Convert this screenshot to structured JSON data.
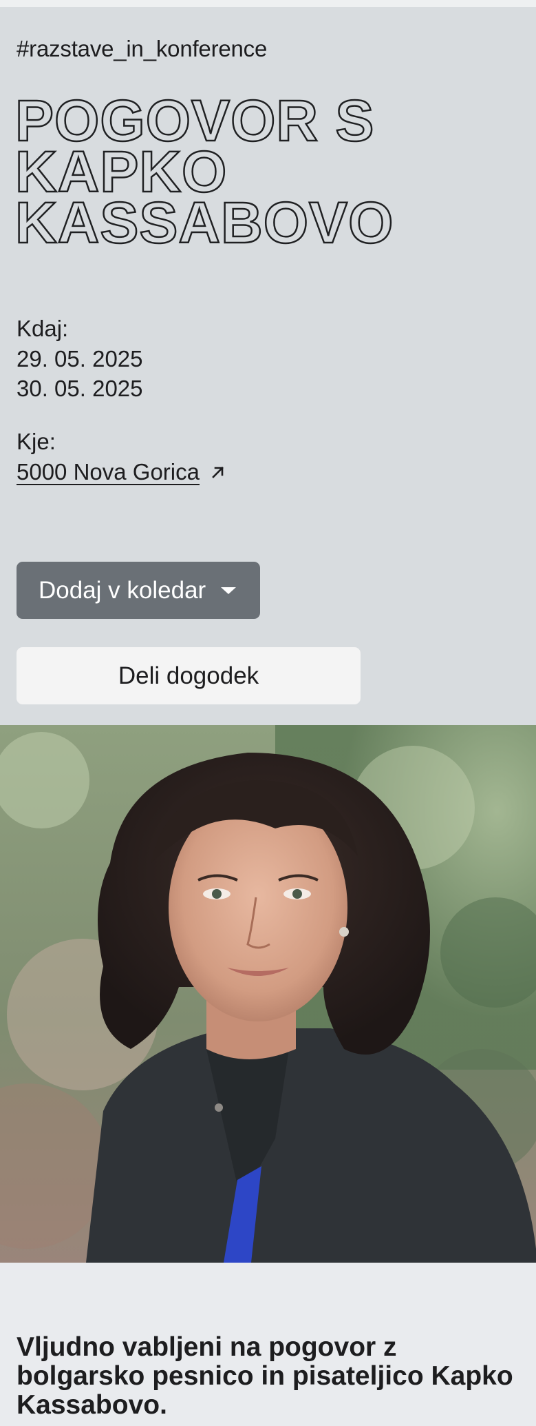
{
  "event": {
    "tag": "#razstave_in_konference",
    "title_lines": [
      "POGOVOR S",
      "KAPKO",
      "KASSABOVO"
    ],
    "when_label": "Kdaj:",
    "dates": [
      "29. 05. 2025",
      "30. 05. 2025"
    ],
    "where_label": "Kje:",
    "place": "5000 Nova Gorica",
    "add_to_calendar_label": "Dodaj v koledar",
    "share_label": "Deli dogodek"
  },
  "photo": {
    "alt": "Kapka Kassabova"
  },
  "intro_text": "Vljudno vabljeni na pogovor z bolgarsko pesnico in pisateljico Kapko Kassabovo.",
  "colors": {
    "hero_bg": "#d8dcdf",
    "page_bg": "#e9ebee",
    "primary_button": "#6a7076",
    "secondary_button": "#f4f4f4",
    "text": "#1d1d1f"
  },
  "icons": {
    "external_link": "arrow-up-right-icon",
    "dropdown": "caret-down-icon"
  }
}
